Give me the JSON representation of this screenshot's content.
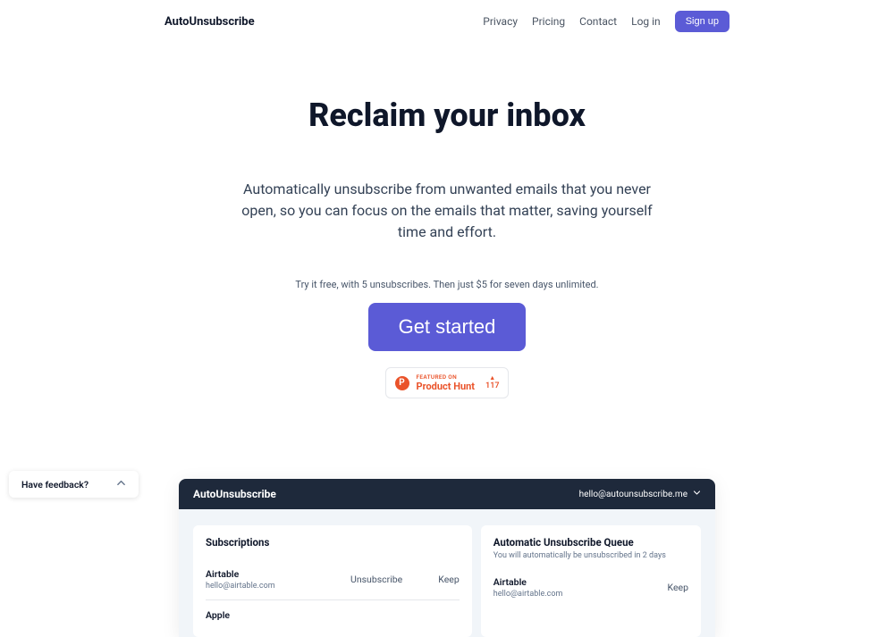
{
  "header": {
    "logo": "AutoUnsubscribe",
    "nav": {
      "privacy": "Privacy",
      "pricing": "Pricing",
      "contact": "Contact",
      "login": "Log in",
      "signup": "Sign up"
    }
  },
  "hero": {
    "title": "Reclaim your inbox",
    "subtitle": "Automatically unsubscribe from unwanted emails that you never open, so you can focus on the emails that matter, saving yourself time and effort.",
    "trial": "Try it free, with 5 unsubscribes. Then just $5 for seven days unlimited.",
    "cta": "Get started",
    "ph": {
      "featured": "FEATURED ON",
      "name": "Product Hunt",
      "count": "117"
    }
  },
  "app": {
    "logo": "AutoUnsubscribe",
    "user_email": "hello@autounsubscribe.me",
    "subscriptions": {
      "title": "Subscriptions",
      "rows": [
        {
          "name": "Airtable",
          "email": "hello@airtable.com"
        },
        {
          "name": "Apple",
          "email": ""
        }
      ],
      "unsubscribe": "Unsubscribe",
      "keep": "Keep"
    },
    "queue": {
      "title": "Automatic Unsubscribe Queue",
      "sub": "You will automatically be unsubscribed in 2 days",
      "row": {
        "name": "Airtable",
        "email": "hello@airtable.com"
      },
      "keep": "Keep"
    }
  },
  "feedback": {
    "label": "Have feedback?"
  }
}
